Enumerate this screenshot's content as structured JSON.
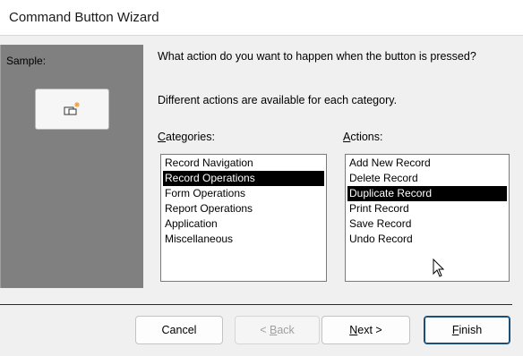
{
  "window": {
    "title": "Command Button Wizard"
  },
  "sample": {
    "label": "Sample:",
    "button_icon": "command-button-glyph-icon"
  },
  "prompt": {
    "question": "What action do you want to happen when the button is pressed?",
    "info": "Different actions are available for each category."
  },
  "categories": {
    "label_hotkey": "C",
    "label_rest": "ategories:",
    "items": [
      {
        "label": "Record Navigation",
        "selected": false
      },
      {
        "label": "Record Operations",
        "selected": true
      },
      {
        "label": "Form Operations",
        "selected": false
      },
      {
        "label": "Report Operations",
        "selected": false
      },
      {
        "label": "Application",
        "selected": false
      },
      {
        "label": "Miscellaneous",
        "selected": false
      }
    ]
  },
  "actions": {
    "label_hotkey": "A",
    "label_rest": "ctions:",
    "items": [
      {
        "label": "Add New Record",
        "selected": false
      },
      {
        "label": "Delete Record",
        "selected": false
      },
      {
        "label": "Duplicate Record",
        "selected": true
      },
      {
        "label": "Print Record",
        "selected": false
      },
      {
        "label": "Save Record",
        "selected": false
      },
      {
        "label": "Undo Record",
        "selected": false
      }
    ]
  },
  "buttons": {
    "cancel": "Cancel",
    "back_prefix": "< ",
    "back_hotkey": "B",
    "back_rest": "ack",
    "next_hotkey": "N",
    "next_rest": "ext >",
    "finish_hotkey": "F",
    "finish_rest": "inish"
  },
  "colors": {
    "sample_panel": "#808080",
    "selection": "#000000",
    "default_button_border": "#1a4f7a"
  }
}
